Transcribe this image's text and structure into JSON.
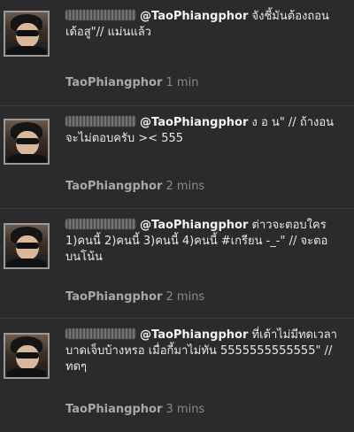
{
  "tweets": [
    {
      "mention": "@TaoPhiangphor",
      "text": " จังชี้มันต้องถอนเด้อสู\"// แม่นแล้ว",
      "author": "TaoPhiangphor",
      "time": "1 min"
    },
    {
      "mention": "@TaoPhiangphor",
      "text": " ง อ น\" // ถ้างอนจะไม่ตอบครับ >< 555",
      "author": "TaoPhiangphor",
      "time": "2 mins"
    },
    {
      "mention": "@TaoPhiangphor",
      "text": " ต่าวจะตอบใคร 1)คนนี้ 2)คนนี้ 3)คนนี้ 4)คนนี้ #เกรียน -_-\" // จะตอบนโน้น",
      "author": "TaoPhiangphor",
      "time": "2 mins"
    },
    {
      "mention": "@TaoPhiangphor",
      "text": " ที่เต้าไม่มีทดเวลาบาดเจ็บบ้างหรอ เมื่อกี้มาไม่ทัน 5555555555555\" // ทดๆ",
      "author": "TaoPhiangphor",
      "time": "3 mins"
    }
  ]
}
